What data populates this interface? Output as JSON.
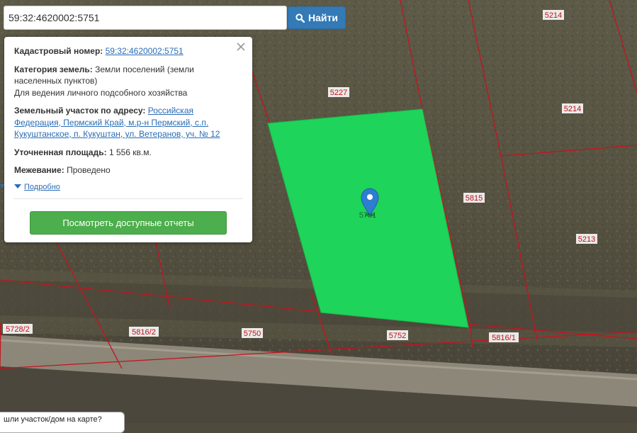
{
  "search": {
    "value": "59:32:4620002:5751",
    "button_label": "Найти"
  },
  "popup": {
    "cadastral_label": "Кадастровый номер:",
    "cadastral_value": "59:32:4620002:5751",
    "category_label": "Категория земель:",
    "category_value": "Земли поселений (земли населенных пунктов)",
    "permitted_use": "Для ведения личного подсобного хозяйства",
    "address_label": "Земельный участок по адресу:",
    "address_value": "Российская Федерация, Пермский Край, м.р-н Пермский, с.п. Кукуштанское, п. Кукуштан, ул. Ветеранов, уч. № 12",
    "area_label": "Уточненная площадь:",
    "area_value": "1 556 кв.м.",
    "survey_label": "Межевание:",
    "survey_value": "Проведено",
    "details_label": "Подробно",
    "reports_button": "Посмотреть доступные отчеты"
  },
  "map": {
    "parcel_labels": {
      "p5214a": "5214",
      "p5227": "5227",
      "p5214b": "5214",
      "p5815": "5815",
      "p5213": "5213",
      "p5751": "5751",
      "p5728_2": "5728/2",
      "p5816_2": "5816/2",
      "p5750": "5750",
      "p5752": "5752",
      "p5816_1": "5816/1"
    },
    "selected_color": "#1ed45a",
    "boundary_color": "#c4141e"
  },
  "tooltip": {
    "text": "шли участок/дом на карте?"
  }
}
